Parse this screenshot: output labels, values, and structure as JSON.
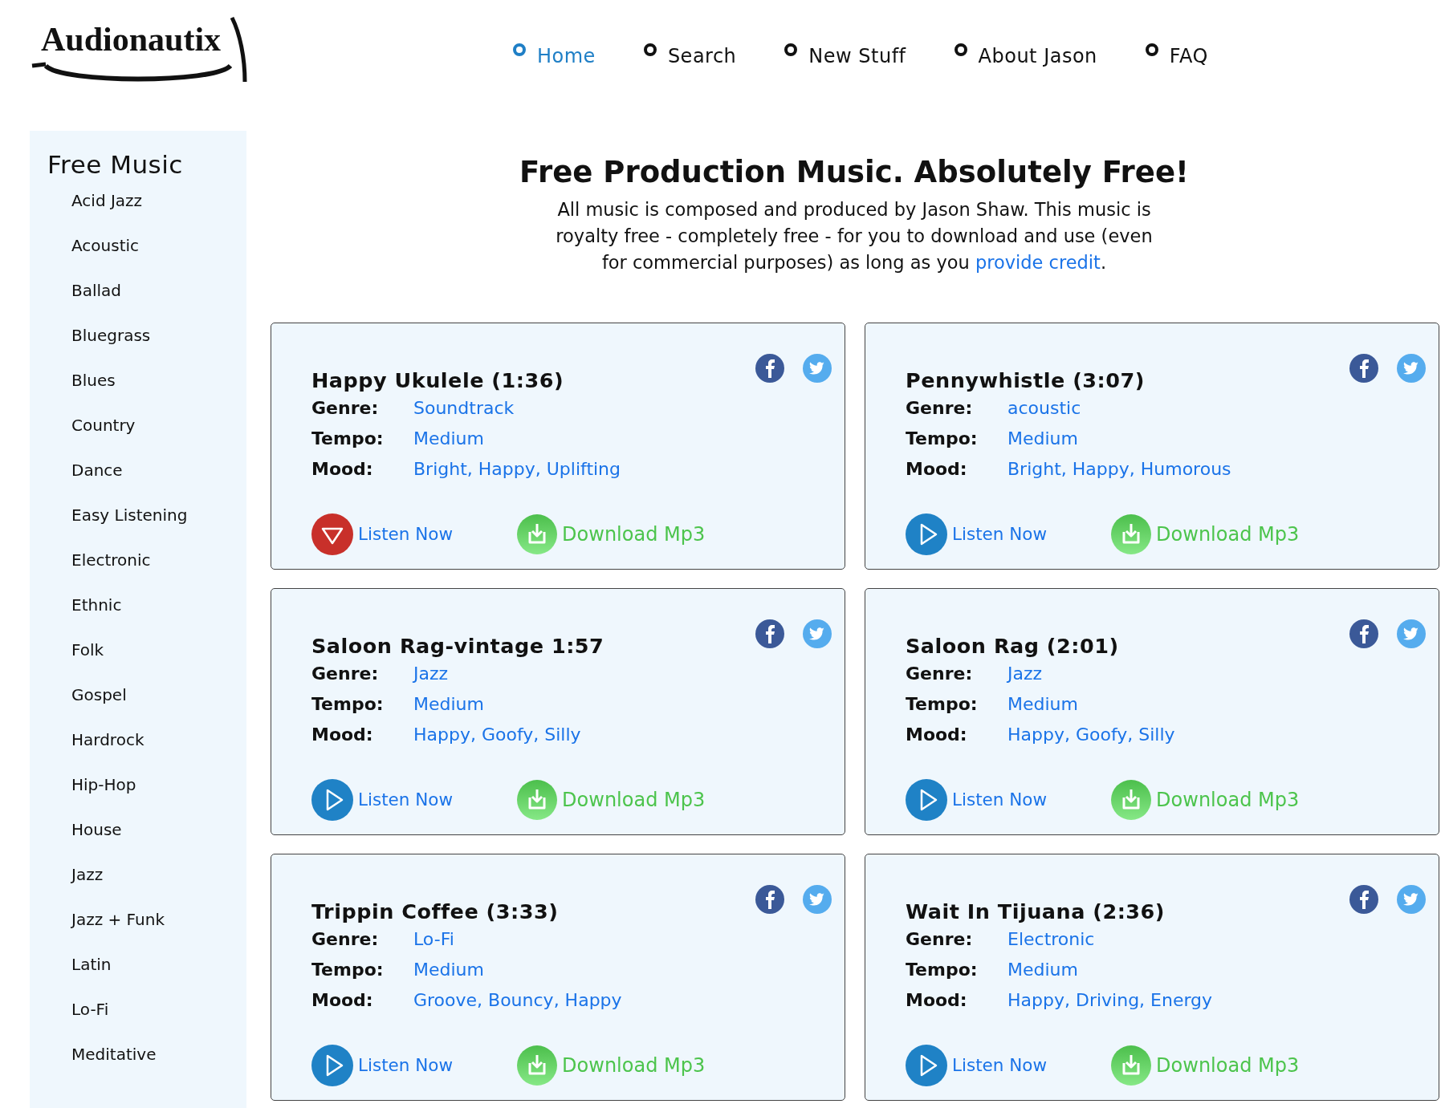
{
  "logo": {
    "text": "Audionautix"
  },
  "nav": [
    {
      "label": "Home",
      "selected": true
    },
    {
      "label": "Search",
      "selected": false
    },
    {
      "label": "New Stuff",
      "selected": false
    },
    {
      "label": "About Jason",
      "selected": false
    },
    {
      "label": "FAQ",
      "selected": false
    }
  ],
  "sidebar": {
    "title": "Free Music",
    "items": [
      "Acid Jazz",
      "Acoustic",
      "Ballad",
      "Bluegrass",
      "Blues",
      "Country",
      "Dance",
      "Easy Listening",
      "Electronic",
      "Ethnic",
      "Folk",
      "Gospel",
      "Hardrock",
      "Hip-Hop",
      "House",
      "Jazz",
      "Jazz + Funk",
      "Latin",
      "Lo-Fi",
      "Meditative"
    ]
  },
  "headline": "Free Production Music. Absolutely Free!",
  "intro": {
    "text": "All music is composed and produced by Jason Shaw. This music is royalty free - completely free - for you to download and use (even for commercial purposes) as long as you",
    "link": "provide credit",
    "tail": "."
  },
  "tracks": [
    {
      "title": "Happy Ukulele (1:36)",
      "fields": [
        {
          "label": "Genre:",
          "value": "Soundtrack"
        },
        {
          "label": "Tempo:",
          "value": "Medium"
        },
        {
          "label": "Mood:",
          "value": "Bright, Happy, Uplifting"
        }
      ],
      "playing": true,
      "listen": "Listen Now",
      "download": "Download Mp3"
    },
    {
      "title": "Pennywhistle (3:07)",
      "fields": [
        {
          "label": "Genre:",
          "value": "acoustic"
        },
        {
          "label": "Tempo:",
          "value": "Medium"
        },
        {
          "label": "Mood:",
          "value": "Bright, Happy, Humorous"
        }
      ],
      "playing": false,
      "listen": "Listen Now",
      "download": "Download Mp3"
    },
    {
      "title": "Saloon Rag-vintage 1:57",
      "fields": [
        {
          "label": "Genre:",
          "value": "Jazz"
        },
        {
          "label": "Tempo:",
          "value": "Medium"
        },
        {
          "label": "Mood:",
          "value": "Happy, Goofy, Silly"
        }
      ],
      "playing": false,
      "listen": "Listen Now",
      "download": "Download Mp3"
    },
    {
      "title": "Saloon Rag (2:01)",
      "fields": [
        {
          "label": "Genre:",
          "value": "Jazz"
        },
        {
          "label": "Tempo:",
          "value": "Medium"
        },
        {
          "label": "Mood:",
          "value": "Happy, Goofy, Silly"
        }
      ],
      "playing": false,
      "listen": "Listen Now",
      "download": "Download Mp3"
    },
    {
      "title": "Trippin Coffee (3:33)",
      "fields": [
        {
          "label": "Genre:",
          "value": "Lo-Fi"
        },
        {
          "label": "Tempo:",
          "value": "Medium"
        },
        {
          "label": "Mood:",
          "value": "Groove, Bouncy, Happy"
        }
      ],
      "playing": false,
      "listen": "Listen Now",
      "download": "Download Mp3"
    },
    {
      "title": "Wait In Tijuana (2:36)",
      "fields": [
        {
          "label": "Genre:",
          "value": "Electronic"
        },
        {
          "label": "Tempo:",
          "value": "Medium"
        },
        {
          "label": "Mood:",
          "value": "Happy, Driving, Energy"
        }
      ],
      "playing": false,
      "listen": "Listen Now",
      "download": "Download Mp3"
    }
  ]
}
